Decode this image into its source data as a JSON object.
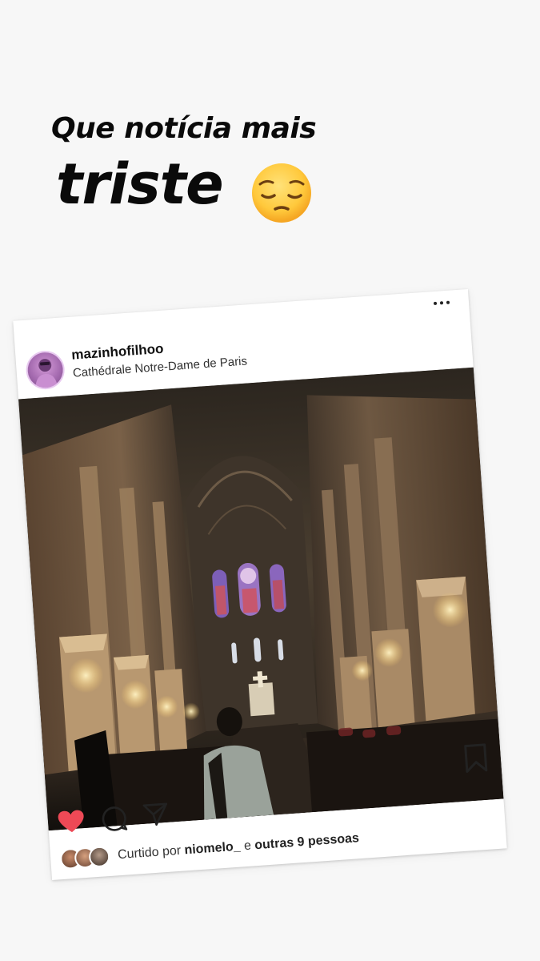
{
  "caption": {
    "line1": "Que notícia mais",
    "line2": "triste"
  },
  "stickers": [
    "pensive-face-emoji"
  ],
  "post": {
    "username": "mazinhofilhoo",
    "location": "Cathédrale Notre-Dame de Paris",
    "likes": {
      "prefix": "Curtido por",
      "user": "niomelo_",
      "connector": "e",
      "others": "outras 9 pessoas"
    },
    "icons": [
      "more-options-icon",
      "bookmark-icon",
      "heart-icon",
      "comment-icon",
      "send-icon"
    ]
  },
  "colors": {
    "background": "#f7f7f7",
    "caption_text": "#0a0a0a",
    "like_red": "#ed4956",
    "card": "#ffffff"
  }
}
